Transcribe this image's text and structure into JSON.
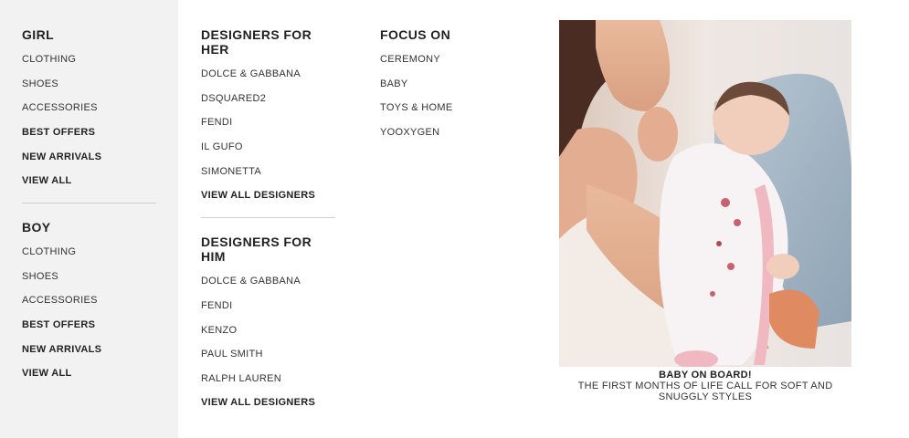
{
  "girl": {
    "heading": "GIRL",
    "items": [
      {
        "label": "CLOTHING",
        "bold": false
      },
      {
        "label": "SHOES",
        "bold": false
      },
      {
        "label": "ACCESSORIES",
        "bold": false
      },
      {
        "label": "BEST OFFERS",
        "bold": true
      },
      {
        "label": "NEW ARRIVALS",
        "bold": true
      },
      {
        "label": "VIEW ALL",
        "bold": true
      }
    ]
  },
  "boy": {
    "heading": "BOY",
    "items": [
      {
        "label": "CLOTHING",
        "bold": false
      },
      {
        "label": "SHOES",
        "bold": false
      },
      {
        "label": "ACCESSORIES",
        "bold": false
      },
      {
        "label": "BEST OFFERS",
        "bold": true
      },
      {
        "label": "NEW ARRIVALS",
        "bold": true
      },
      {
        "label": "VIEW ALL",
        "bold": true
      }
    ]
  },
  "designers_her": {
    "heading": "DESIGNERS FOR HER",
    "items": [
      {
        "label": "DOLCE & GABBANA",
        "bold": false
      },
      {
        "label": "DSQUARED2",
        "bold": false
      },
      {
        "label": "FENDI",
        "bold": false
      },
      {
        "label": "IL GUFO",
        "bold": false
      },
      {
        "label": "SIMONETTA",
        "bold": false
      },
      {
        "label": "VIEW ALL DESIGNERS",
        "bold": true
      }
    ]
  },
  "designers_him": {
    "heading": "DESIGNERS FOR HIM",
    "items": [
      {
        "label": "DOLCE & GABBANA",
        "bold": false
      },
      {
        "label": "FENDI",
        "bold": false
      },
      {
        "label": "KENZO",
        "bold": false
      },
      {
        "label": "PAUL SMITH",
        "bold": false
      },
      {
        "label": "RALPH LAUREN",
        "bold": false
      },
      {
        "label": "VIEW ALL DESIGNERS",
        "bold": true
      }
    ]
  },
  "focus": {
    "heading": "FOCUS ON",
    "items": [
      {
        "label": "CEREMONY",
        "bold": false
      },
      {
        "label": "BABY",
        "bold": false
      },
      {
        "label": "TOYS & HOME",
        "bold": false
      },
      {
        "label": "YOOXYGEN",
        "bold": false
      }
    ]
  },
  "promo": {
    "title": "BABY ON BOARD!",
    "subtitle": "THE FIRST MONTHS OF LIFE CALL FOR SOFT AND SNUGGLY STYLES"
  }
}
